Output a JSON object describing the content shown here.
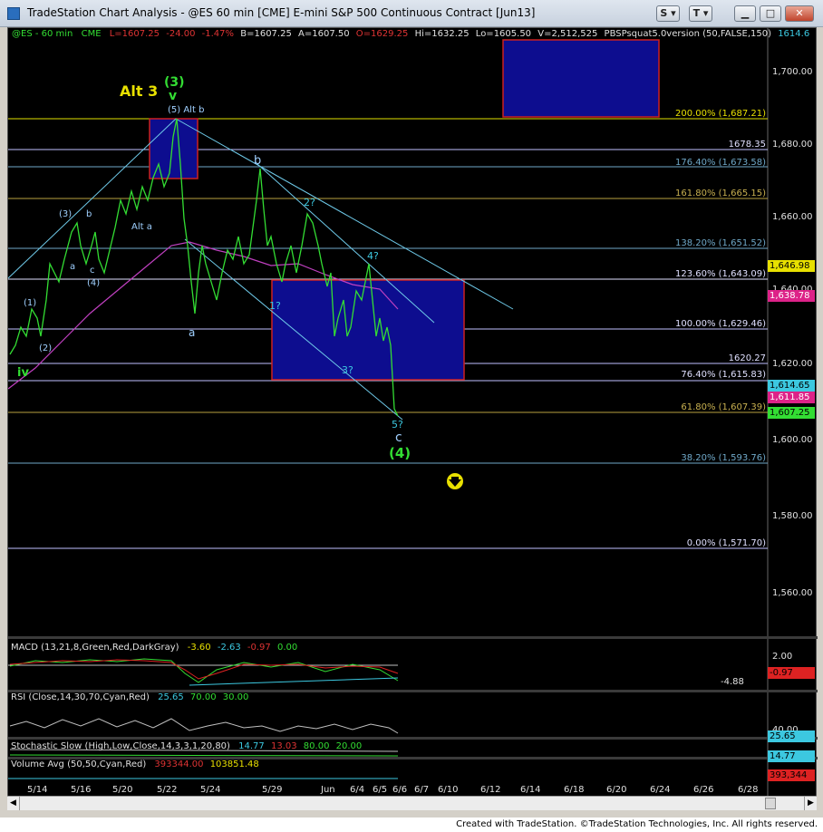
{
  "window": {
    "title": "TradeStation Chart Analysis - @ES 60 min [CME] E-mini S&P 500 Continuous Contract [Jun13]",
    "btn_s": "S",
    "btn_t": "T",
    "colors": {
      "bg": "#000000",
      "price": "#33cc33",
      "grid": "#c0c0ff"
    }
  },
  "header": {
    "symbol": "@ES - 60 min",
    "exchange": "CME",
    "last": "L=1607.25",
    "chg": "-24.00",
    "pct": "-1.47%",
    "bid": "B=1607.25",
    "ask": "A=1607.50",
    "open": "O=1629.25",
    "high": "Hi=1632.25",
    "low": "Lo=1605.50",
    "vol": "V=2,512,525",
    "study": "PBSPsquat5.0version (50,FALSE,150)",
    "study_val": "1614.6"
  },
  "axis": {
    "y_ticks": [
      "1,700.00",
      "1,680.00",
      "1,660.00",
      "1,640.00",
      "1,620.00",
      "1,600.00",
      "1,580.00",
      "1,560.00"
    ],
    "x_ticks": [
      "5/14",
      "5/16",
      "5/20",
      "5/22",
      "5/24",
      "5/29",
      "Jun",
      "6/4",
      "6/5",
      "6/6",
      "6/7",
      "6/10",
      "6/12",
      "6/14",
      "6/18",
      "6/20",
      "6/24",
      "6/26",
      "6/28"
    ]
  },
  "fib_labels": [
    "200.00% (1,687.21)",
    "1678.35",
    "176.40% (1,673.58)",
    "161.80% (1,665.15)",
    "138.20% (1,651.52)",
    "123.60% (1,643.09)",
    "100.00% (1,629.46)",
    "1620.27",
    "76.40% (1,615.83)",
    "61.80% (1,607.39)",
    "38.20% (1,593.76)",
    "0.00% (1,571.70)"
  ],
  "price_tags": [
    "1,646.98",
    "1,638.78",
    "1,614.65",
    "1,611.85",
    "1,607.25"
  ],
  "wave_labels": {
    "alt3": "Alt 3",
    "three": "(3)",
    "v": "v",
    "five_altb": "(5)  Alt b",
    "b": "b",
    "two_q": "2?",
    "four_q": "4?",
    "one_q": "1?",
    "three_q": "3?",
    "five_q": "5?",
    "c": "c",
    "four": "(4)",
    "a": "a",
    "alt_a": "Alt a",
    "w1": "(1)",
    "w2": "(2)",
    "w3": "(3)",
    "w4": "(4)",
    "wa": "a",
    "wb": "b",
    "wc": "c",
    "iv": "iv"
  },
  "macd": {
    "label": "MACD (13,21,8,Green,Red,DarkGray)",
    "v1": "-3.60",
    "v2": "-2.63",
    "v3": "-0.97",
    "v4": "0.00",
    "ticks": [
      "2.00",
      "-0.97",
      "-4.88"
    ]
  },
  "rsi": {
    "label": "RSI (Close,14,30,70,Cyan,Red)",
    "v1": "25.65",
    "v2": "70.00",
    "v3": "30.00",
    "ticks": [
      "40.00",
      "25.65"
    ]
  },
  "stoch": {
    "label": "Stochastic Slow (High,Low,Close,14,3,3,1,20,80)",
    "v1": "14.77",
    "v2": "13.03",
    "v3": "80.00",
    "v4": "20.00",
    "ticks": [
      "14.77"
    ]
  },
  "volume": {
    "label": "Volume Avg (50,50,Cyan,Red)",
    "v1": "393344.00",
    "v2": "103851.48",
    "ticks": [
      "393,344"
    ]
  },
  "footer": "Created with TradeStation. ©TradeStation Technologies, Inc. All rights reserved."
}
